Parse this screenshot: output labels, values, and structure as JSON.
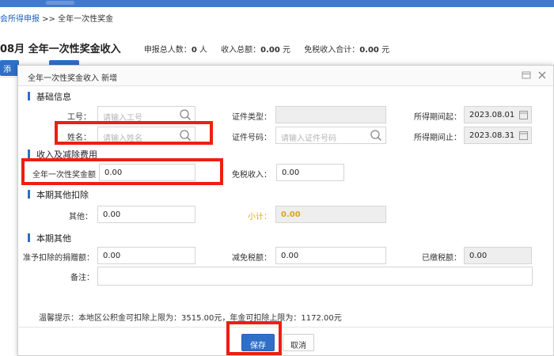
{
  "background": {
    "breadcrumb": {
      "link": "会所得申报",
      "separator": " >> ",
      "current": "全年一次性奖金"
    },
    "summary": {
      "title": "08月 全年一次性奖金收入",
      "declared_count_label": "申报总人数：",
      "declared_count": "0",
      "declared_count_unit": " 人",
      "income_total_label": "收入总额：",
      "income_total": "0.00",
      "income_total_unit": " 元",
      "tax_free_total_label": "免税收入合计：",
      "tax_free_total": "0.00",
      "tax_free_total_unit": " 元"
    },
    "add_button_label": "添"
  },
  "dialog": {
    "title": "全年一次性奖金收入 新增",
    "icons": [
      "window-icon",
      "close-icon"
    ],
    "sections": {
      "basic": "基础信息",
      "income": "收入及减除费用",
      "other_deduction": "本期其他扣除",
      "other": "本期其他"
    },
    "basic": {
      "employee_id_label": "工号：",
      "employee_id_placeholder": "请输入工号",
      "id_type_label": "证件类型：",
      "id_type_value": "",
      "period_start_label": "所得期间起：",
      "period_start_value": "2023.08.01",
      "name_label": "姓名：",
      "name_placeholder": "请输入姓名",
      "id_number_label": "证件号码：",
      "id_number_placeholder": "请输入证件号码",
      "period_end_label": "所得期间止：",
      "period_end_value": "2023.08.31"
    },
    "income": {
      "bonus_label": "全年一次性奖金额",
      "bonus_value": "0.00",
      "tax_free_label": "免税收入：",
      "tax_free_value": "0.00"
    },
    "other_deduction": {
      "other_label": "其他：",
      "other_value": "0.00",
      "subtotal_label": "小计：",
      "subtotal_value": "0.00"
    },
    "other": {
      "donation_label": "准予扣除的捐赠额：",
      "donation_value": "0.00",
      "tax_reduction_label": "减免税额：",
      "tax_reduction_value": "0.00",
      "tax_paid_label": "已缴税额：",
      "tax_paid_value": "0.00",
      "remark_label": "备注：",
      "remark_value": ""
    },
    "tip": "温馨提示：本地区公积金可扣除上限为：3515.00元，年金可扣除上限为：1172.00元",
    "buttons": {
      "save": "保存",
      "cancel": "取消"
    }
  },
  "colors": {
    "primary": "#2f6fc8",
    "annotation": "#ee1e12",
    "subtotal": "#d9a61c"
  }
}
